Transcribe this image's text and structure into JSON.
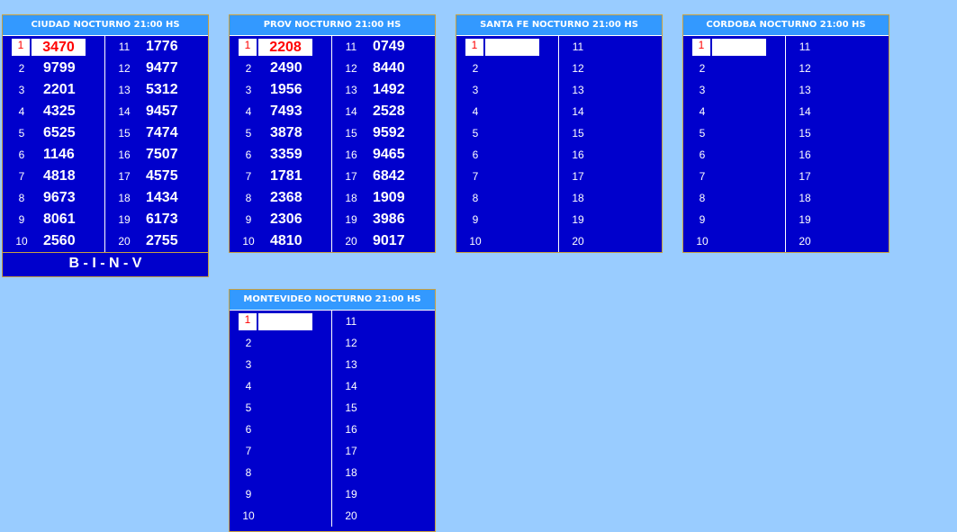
{
  "boards": [
    {
      "title": "CIUDAD NOCTURNO 21:00 HS",
      "footer": "B - I - N - V",
      "left": [
        {
          "pos": "1",
          "num": "3470"
        },
        {
          "pos": "2",
          "num": "9799"
        },
        {
          "pos": "3",
          "num": "2201"
        },
        {
          "pos": "4",
          "num": "4325"
        },
        {
          "pos": "5",
          "num": "6525"
        },
        {
          "pos": "6",
          "num": "1146"
        },
        {
          "pos": "7",
          "num": "4818"
        },
        {
          "pos": "8",
          "num": "9673"
        },
        {
          "pos": "9",
          "num": "8061"
        },
        {
          "pos": "10",
          "num": "2560"
        }
      ],
      "right": [
        {
          "pos": "11",
          "num": "1776"
        },
        {
          "pos": "12",
          "num": "9477"
        },
        {
          "pos": "13",
          "num": "5312"
        },
        {
          "pos": "14",
          "num": "9457"
        },
        {
          "pos": "15",
          "num": "7474"
        },
        {
          "pos": "16",
          "num": "7507"
        },
        {
          "pos": "17",
          "num": "4575"
        },
        {
          "pos": "18",
          "num": "1434"
        },
        {
          "pos": "19",
          "num": "6173"
        },
        {
          "pos": "20",
          "num": "2755"
        }
      ]
    },
    {
      "title": "PROV NOCTURNO 21:00 HS",
      "left": [
        {
          "pos": "1",
          "num": "2208"
        },
        {
          "pos": "2",
          "num": "2490"
        },
        {
          "pos": "3",
          "num": "1956"
        },
        {
          "pos": "4",
          "num": "7493"
        },
        {
          "pos": "5",
          "num": "3878"
        },
        {
          "pos": "6",
          "num": "3359"
        },
        {
          "pos": "7",
          "num": "1781"
        },
        {
          "pos": "8",
          "num": "2368"
        },
        {
          "pos": "9",
          "num": "2306"
        },
        {
          "pos": "10",
          "num": "4810"
        }
      ],
      "right": [
        {
          "pos": "11",
          "num": "0749"
        },
        {
          "pos": "12",
          "num": "8440"
        },
        {
          "pos": "13",
          "num": "1492"
        },
        {
          "pos": "14",
          "num": "2528"
        },
        {
          "pos": "15",
          "num": "9592"
        },
        {
          "pos": "16",
          "num": "9465"
        },
        {
          "pos": "17",
          "num": "6842"
        },
        {
          "pos": "18",
          "num": "1909"
        },
        {
          "pos": "19",
          "num": "3986"
        },
        {
          "pos": "20",
          "num": "9017"
        }
      ]
    },
    {
      "title": "SANTA FE NOCTURNO 21:00 HS",
      "left": [
        {
          "pos": "1",
          "num": ""
        },
        {
          "pos": "2",
          "num": ""
        },
        {
          "pos": "3",
          "num": ""
        },
        {
          "pos": "4",
          "num": ""
        },
        {
          "pos": "5",
          "num": ""
        },
        {
          "pos": "6",
          "num": ""
        },
        {
          "pos": "7",
          "num": ""
        },
        {
          "pos": "8",
          "num": ""
        },
        {
          "pos": "9",
          "num": ""
        },
        {
          "pos": "10",
          "num": ""
        }
      ],
      "right": [
        {
          "pos": "11",
          "num": ""
        },
        {
          "pos": "12",
          "num": ""
        },
        {
          "pos": "13",
          "num": ""
        },
        {
          "pos": "14",
          "num": ""
        },
        {
          "pos": "15",
          "num": ""
        },
        {
          "pos": "16",
          "num": ""
        },
        {
          "pos": "17",
          "num": ""
        },
        {
          "pos": "18",
          "num": ""
        },
        {
          "pos": "19",
          "num": ""
        },
        {
          "pos": "20",
          "num": ""
        }
      ]
    },
    {
      "title": "CORDOBA NOCTURNO 21:00 HS",
      "left": [
        {
          "pos": "1",
          "num": ""
        },
        {
          "pos": "2",
          "num": ""
        },
        {
          "pos": "3",
          "num": ""
        },
        {
          "pos": "4",
          "num": ""
        },
        {
          "pos": "5",
          "num": ""
        },
        {
          "pos": "6",
          "num": ""
        },
        {
          "pos": "7",
          "num": ""
        },
        {
          "pos": "8",
          "num": ""
        },
        {
          "pos": "9",
          "num": ""
        },
        {
          "pos": "10",
          "num": ""
        }
      ],
      "right": [
        {
          "pos": "11",
          "num": ""
        },
        {
          "pos": "12",
          "num": ""
        },
        {
          "pos": "13",
          "num": ""
        },
        {
          "pos": "14",
          "num": ""
        },
        {
          "pos": "15",
          "num": ""
        },
        {
          "pos": "16",
          "num": ""
        },
        {
          "pos": "17",
          "num": ""
        },
        {
          "pos": "18",
          "num": ""
        },
        {
          "pos": "19",
          "num": ""
        },
        {
          "pos": "20",
          "num": ""
        }
      ]
    },
    {
      "title": "MONTEVIDEO NOCTURNO 21:00 HS",
      "left": [
        {
          "pos": "1",
          "num": ""
        },
        {
          "pos": "2",
          "num": ""
        },
        {
          "pos": "3",
          "num": ""
        },
        {
          "pos": "4",
          "num": ""
        },
        {
          "pos": "5",
          "num": ""
        },
        {
          "pos": "6",
          "num": ""
        },
        {
          "pos": "7",
          "num": ""
        },
        {
          "pos": "8",
          "num": ""
        },
        {
          "pos": "9",
          "num": ""
        },
        {
          "pos": "10",
          "num": ""
        }
      ],
      "right": [
        {
          "pos": "11",
          "num": ""
        },
        {
          "pos": "12",
          "num": ""
        },
        {
          "pos": "13",
          "num": ""
        },
        {
          "pos": "14",
          "num": ""
        },
        {
          "pos": "15",
          "num": ""
        },
        {
          "pos": "16",
          "num": ""
        },
        {
          "pos": "17",
          "num": ""
        },
        {
          "pos": "18",
          "num": ""
        },
        {
          "pos": "19",
          "num": ""
        },
        {
          "pos": "20",
          "num": ""
        }
      ]
    }
  ]
}
